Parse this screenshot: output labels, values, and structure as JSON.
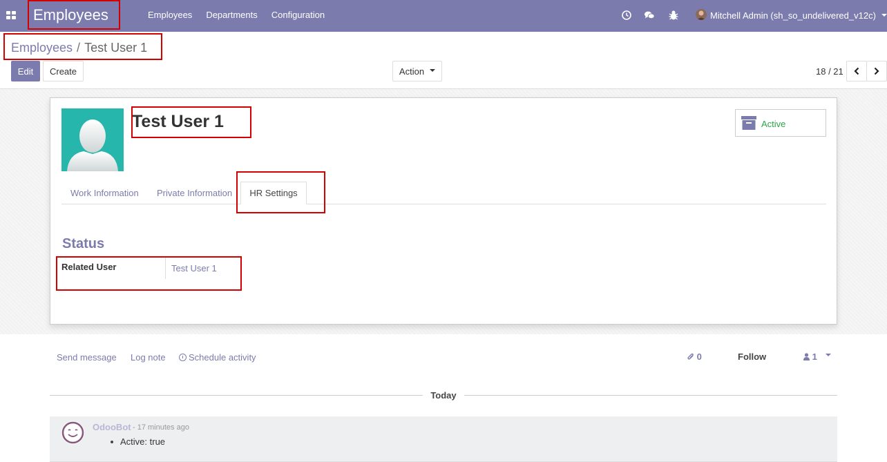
{
  "navbar": {
    "app_name": "Employees",
    "menu": [
      "Employees",
      "Departments",
      "Configuration"
    ],
    "user_label": "Mitchell Admin (sh_so_undelivered_v12c)",
    "icons": [
      "clock-icon",
      "chat-icon",
      "bug-icon"
    ]
  },
  "breadcrumb": {
    "parent": "Employees",
    "separator": "/",
    "current": "Test User 1"
  },
  "toolbar": {
    "edit_label": "Edit",
    "create_label": "Create",
    "action_label": "Action",
    "pager": "18 / 21"
  },
  "employee": {
    "name": "Test User 1",
    "status_button": "Active",
    "tabs": [
      "Work Information",
      "Private Information",
      "HR Settings"
    ],
    "active_tab": "HR Settings",
    "section_title": "Status",
    "fields": [
      {
        "label": "Related User",
        "value": "Test User 1"
      }
    ]
  },
  "chatter": {
    "send_message": "Send message",
    "log_note": "Log note",
    "schedule_activity": "Schedule activity",
    "attachments_count": "0",
    "follow_label": "Follow",
    "followers_count": "1",
    "date_separator": "Today",
    "messages": [
      {
        "author": "OdooBot",
        "time": "- 17 minutes ago",
        "body": "Active: true"
      }
    ]
  },
  "colors": {
    "brand": "#7c7bad",
    "highlight": "#d40000",
    "active_green": "#28a745",
    "avatar_bg": "#27b6ac"
  }
}
